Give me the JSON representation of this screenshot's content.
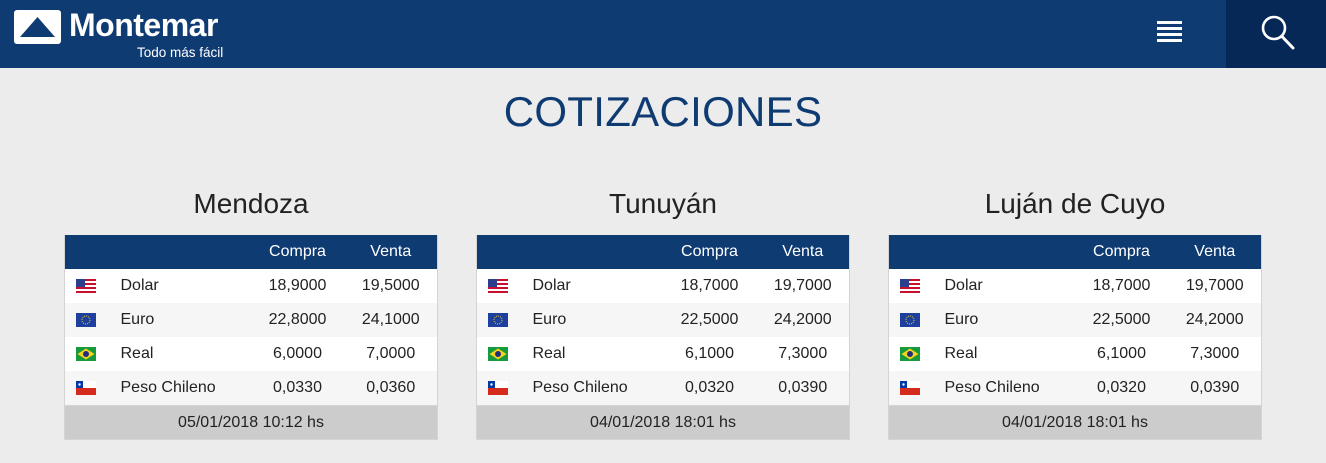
{
  "header": {
    "logo_text": "Montemar",
    "tagline": "Todo más fácil",
    "brand_color": "#0f3b73",
    "search_bg": "#052856"
  },
  "page": {
    "title": "COTIZACIONES"
  },
  "table_headers": {
    "compra": "Compra",
    "venta": "Venta"
  },
  "branches": [
    {
      "name": "Mendoza",
      "rows": [
        {
          "flag": "usa-flag-icon",
          "currency": "Dolar",
          "compra": "18,9000",
          "venta": "19,5000"
        },
        {
          "flag": "eu-flag-icon",
          "currency": "Euro",
          "compra": "22,8000",
          "venta": "24,1000"
        },
        {
          "flag": "brazil-flag-icon",
          "currency": "Real",
          "compra": "6,0000",
          "venta": "7,0000"
        },
        {
          "flag": "chile-flag-icon",
          "currency": "Peso Chileno",
          "compra": "0,0330",
          "venta": "0,0360"
        }
      ],
      "updated": "05/01/2018 10:12 hs"
    },
    {
      "name": "Tunuyán",
      "rows": [
        {
          "flag": "usa-flag-icon",
          "currency": "Dolar",
          "compra": "18,7000",
          "venta": "19,7000"
        },
        {
          "flag": "eu-flag-icon",
          "currency": "Euro",
          "compra": "22,5000",
          "venta": "24,2000"
        },
        {
          "flag": "brazil-flag-icon",
          "currency": "Real",
          "compra": "6,1000",
          "venta": "7,3000"
        },
        {
          "flag": "chile-flag-icon",
          "currency": "Peso Chileno",
          "compra": "0,0320",
          "venta": "0,0390"
        }
      ],
      "updated": "04/01/2018 18:01 hs"
    },
    {
      "name": "Luján de Cuyo",
      "rows": [
        {
          "flag": "usa-flag-icon",
          "currency": "Dolar",
          "compra": "18,7000",
          "venta": "19,7000"
        },
        {
          "flag": "eu-flag-icon",
          "currency": "Euro",
          "compra": "22,5000",
          "venta": "24,2000"
        },
        {
          "flag": "brazil-flag-icon",
          "currency": "Real",
          "compra": "6,1000",
          "venta": "7,3000"
        },
        {
          "flag": "chile-flag-icon",
          "currency": "Peso Chileno",
          "compra": "0,0320",
          "venta": "0,0390"
        }
      ],
      "updated": "04/01/2018 18:01 hs"
    }
  ]
}
